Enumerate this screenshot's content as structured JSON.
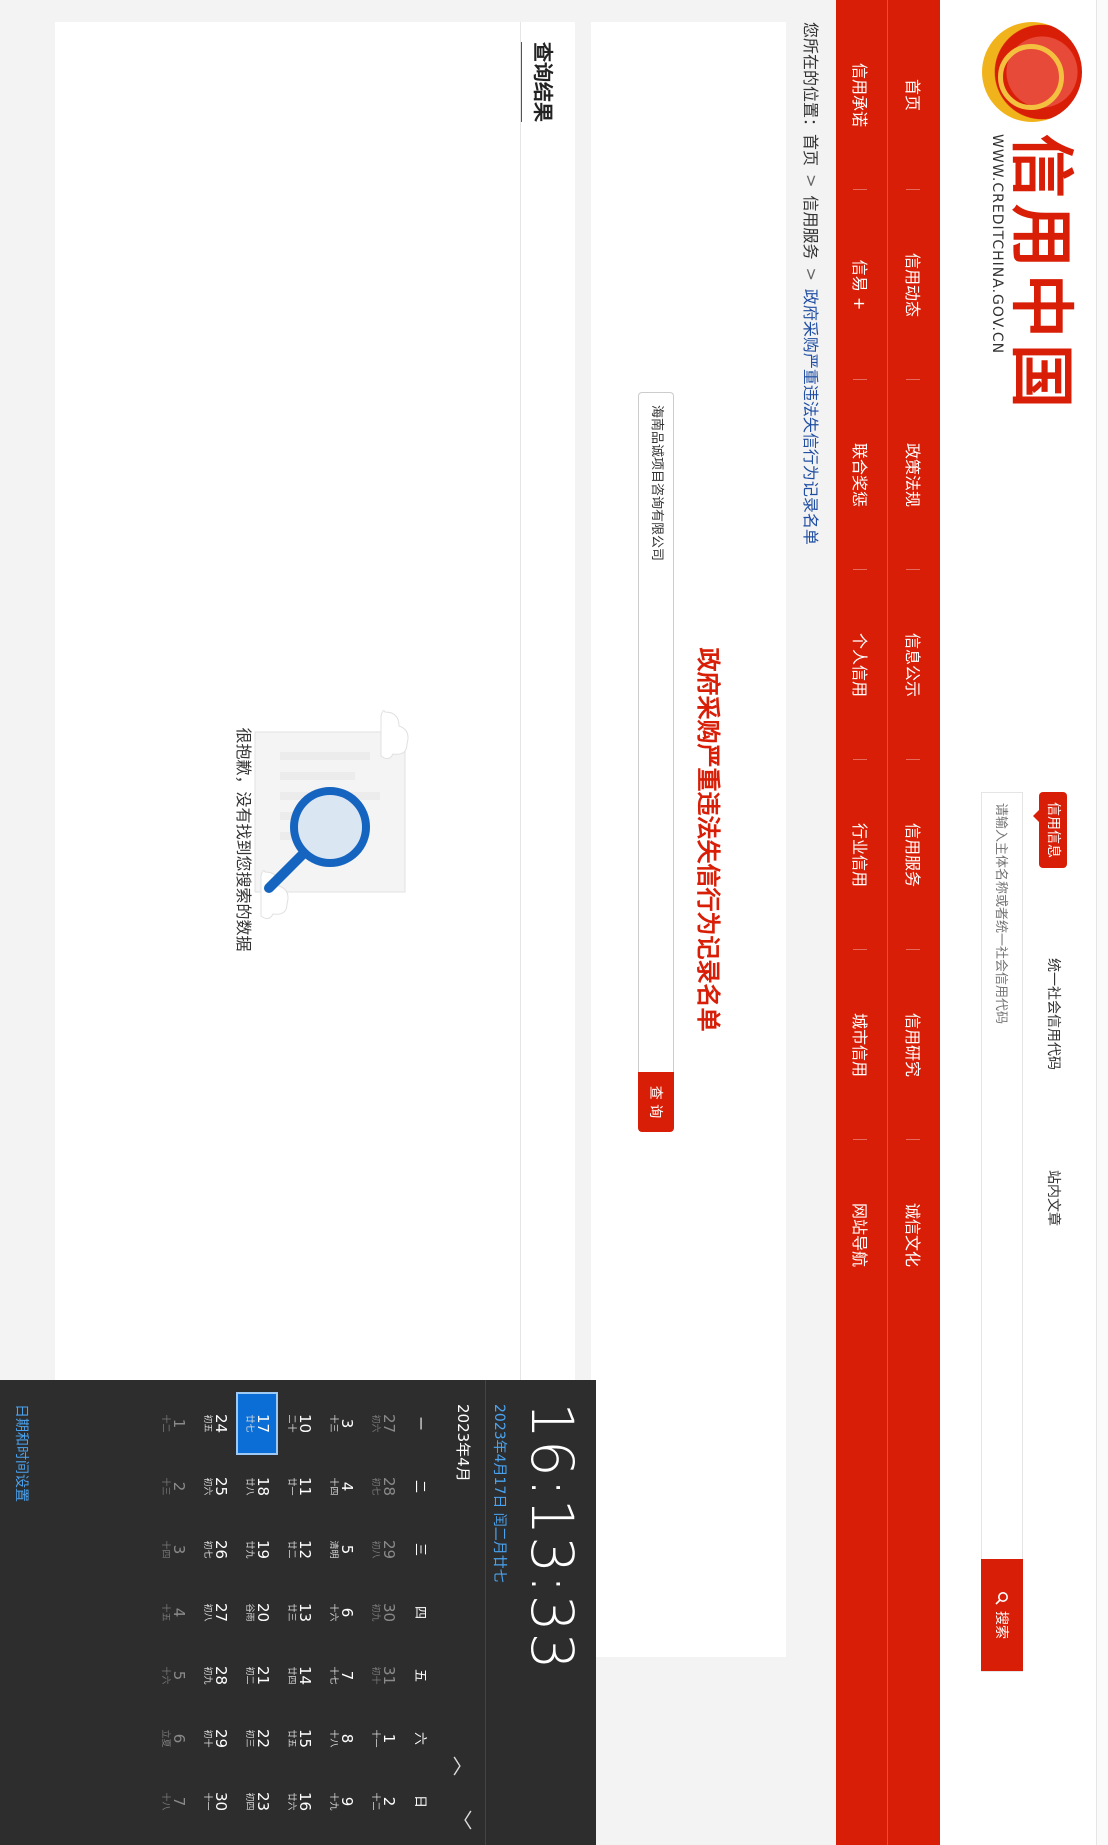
{
  "header": {
    "logo_cn": "信用中国",
    "logo_en": "WWW.CREDITCHINA.GOV.CN",
    "search_tabs": [
      "信用信息",
      "统一社会信用代码",
      "站内文章"
    ],
    "search_placeholder": "请输入主体名称或者统一社会信用代码",
    "search_button": "搜索"
  },
  "nav": {
    "row1": [
      "首页",
      "信用动态",
      "政策法规",
      "信息公示",
      "信用服务",
      "信用研究",
      "诚信文化"
    ],
    "row2": [
      "信用承诺",
      "信易 +",
      "联合奖惩",
      "个人信用",
      "行业信用",
      "城市信用",
      "网站导航"
    ]
  },
  "breadcrumb": {
    "prefix": "您所在的位置：",
    "items": [
      "首页",
      "信用服务",
      "政府采购严重违法失信行为记录名单"
    ],
    "sep": ">"
  },
  "query": {
    "title": "政府采购严重违法失信行为记录名单",
    "input_value": "海南品诚项目咨询有限公司",
    "button": "查 询"
  },
  "results": {
    "title": "查询结果",
    "empty_text": "很抱歉，没有找到您搜索的数据"
  },
  "clock": {
    "time": "16:13:33",
    "date": "2023年4月17日 闰二月廿七",
    "month": "2023年4月",
    "weekdays": [
      "一",
      "二",
      "三",
      "四",
      "五",
      "六",
      "日"
    ],
    "weeks": [
      [
        {
          "d": "27",
          "l": "初六",
          "o": true
        },
        {
          "d": "28",
          "l": "初七",
          "o": true
        },
        {
          "d": "29",
          "l": "初八",
          "o": true
        },
        {
          "d": "30",
          "l": "初九",
          "o": true
        },
        {
          "d": "31",
          "l": "初十",
          "o": true
        },
        {
          "d": "1",
          "l": "十一"
        },
        {
          "d": "2",
          "l": "十二"
        }
      ],
      [
        {
          "d": "3",
          "l": "十三"
        },
        {
          "d": "4",
          "l": "十四"
        },
        {
          "d": "5",
          "l": "清明"
        },
        {
          "d": "6",
          "l": "十六"
        },
        {
          "d": "7",
          "l": "十七"
        },
        {
          "d": "8",
          "l": "十八"
        },
        {
          "d": "9",
          "l": "十九"
        }
      ],
      [
        {
          "d": "10",
          "l": "二十"
        },
        {
          "d": "11",
          "l": "廿一"
        },
        {
          "d": "12",
          "l": "廿二"
        },
        {
          "d": "13",
          "l": "廿三"
        },
        {
          "d": "14",
          "l": "廿四"
        },
        {
          "d": "15",
          "l": "廿五"
        },
        {
          "d": "16",
          "l": "廿六"
        }
      ],
      [
        {
          "d": "17",
          "l": "廿七",
          "t": true
        },
        {
          "d": "18",
          "l": "廿八"
        },
        {
          "d": "19",
          "l": "廿九"
        },
        {
          "d": "20",
          "l": "谷雨"
        },
        {
          "d": "21",
          "l": "初二"
        },
        {
          "d": "22",
          "l": "初三"
        },
        {
          "d": "23",
          "l": "初四"
        }
      ],
      [
        {
          "d": "24",
          "l": "初五"
        },
        {
          "d": "25",
          "l": "初六"
        },
        {
          "d": "26",
          "l": "初七"
        },
        {
          "d": "27",
          "l": "初八"
        },
        {
          "d": "28",
          "l": "初九"
        },
        {
          "d": "29",
          "l": "初十"
        },
        {
          "d": "30",
          "l": "十一"
        }
      ],
      [
        {
          "d": "1",
          "l": "十二",
          "o": true
        },
        {
          "d": "2",
          "l": "十三",
          "o": true
        },
        {
          "d": "3",
          "l": "十四",
          "o": true
        },
        {
          "d": "4",
          "l": "十五",
          "o": true
        },
        {
          "d": "5",
          "l": "十六",
          "o": true
        },
        {
          "d": "6",
          "l": "立夏",
          "o": true
        },
        {
          "d": "7",
          "l": "十八",
          "o": true
        }
      ]
    ],
    "settings_link": "日期和时间设置"
  },
  "colors": {
    "brand_red": "#d81e06",
    "link_blue": "#1f4ea3",
    "flyout_bg": "#2d2d2d",
    "today_blue": "#0b6ed6"
  }
}
